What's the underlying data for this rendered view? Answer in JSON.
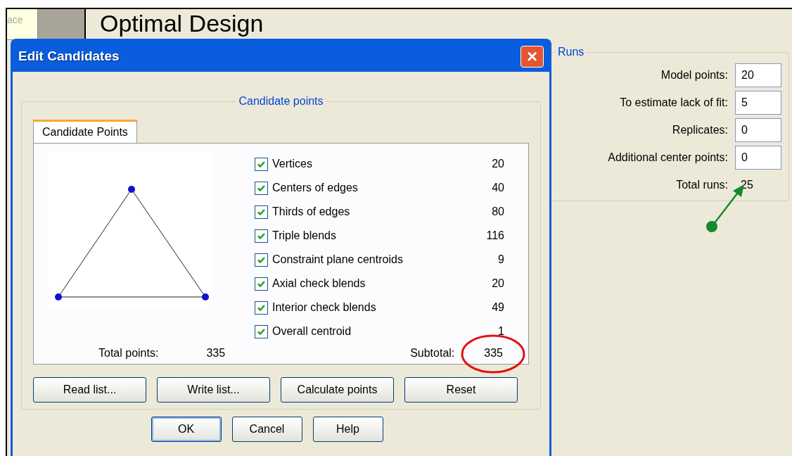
{
  "sidebar_tab": {
    "label": "ace"
  },
  "page_title": "Optimal Design",
  "runs": {
    "legend": "Runs",
    "fields": [
      {
        "label": "Model points:",
        "value": "20"
      },
      {
        "label": "To estimate lack of fit:",
        "value": "5"
      },
      {
        "label": "Replicates:",
        "value": "0"
      },
      {
        "label": "Additional center points:",
        "value": "0"
      }
    ],
    "total_label": "Total runs:",
    "total_value": "25"
  },
  "dialog": {
    "title": "Edit Candidates",
    "close": "×",
    "group_legend": "Candidate points",
    "tabs": [
      {
        "label": "Candidate Points",
        "selected": true
      }
    ],
    "items": [
      {
        "label": "Vertices",
        "count": "20",
        "checked": true
      },
      {
        "label": "Centers of edges",
        "count": "40",
        "checked": true
      },
      {
        "label": "Thirds of edges",
        "count": "80",
        "checked": true
      },
      {
        "label": "Triple blends",
        "count": "116",
        "checked": true
      },
      {
        "label": "Constraint plane centroids",
        "count": "9",
        "checked": true
      },
      {
        "label": "Axial check blends",
        "count": "20",
        "checked": true
      },
      {
        "label": "Interior check blends",
        "count": "49",
        "checked": true
      },
      {
        "label": "Overall centroid",
        "count": "1",
        "checked": true
      }
    ],
    "total_label": "Total points:",
    "total_value": "335",
    "subtotal_label": "Subtotal:",
    "subtotal_value": "335",
    "list_buttons": [
      "Read list...",
      "Write list...",
      "Calculate points",
      "Reset"
    ],
    "footer_buttons": [
      {
        "label": "OK",
        "default": true
      },
      {
        "label": "Cancel",
        "default": false
      },
      {
        "label": "Help",
        "default": false
      }
    ]
  }
}
